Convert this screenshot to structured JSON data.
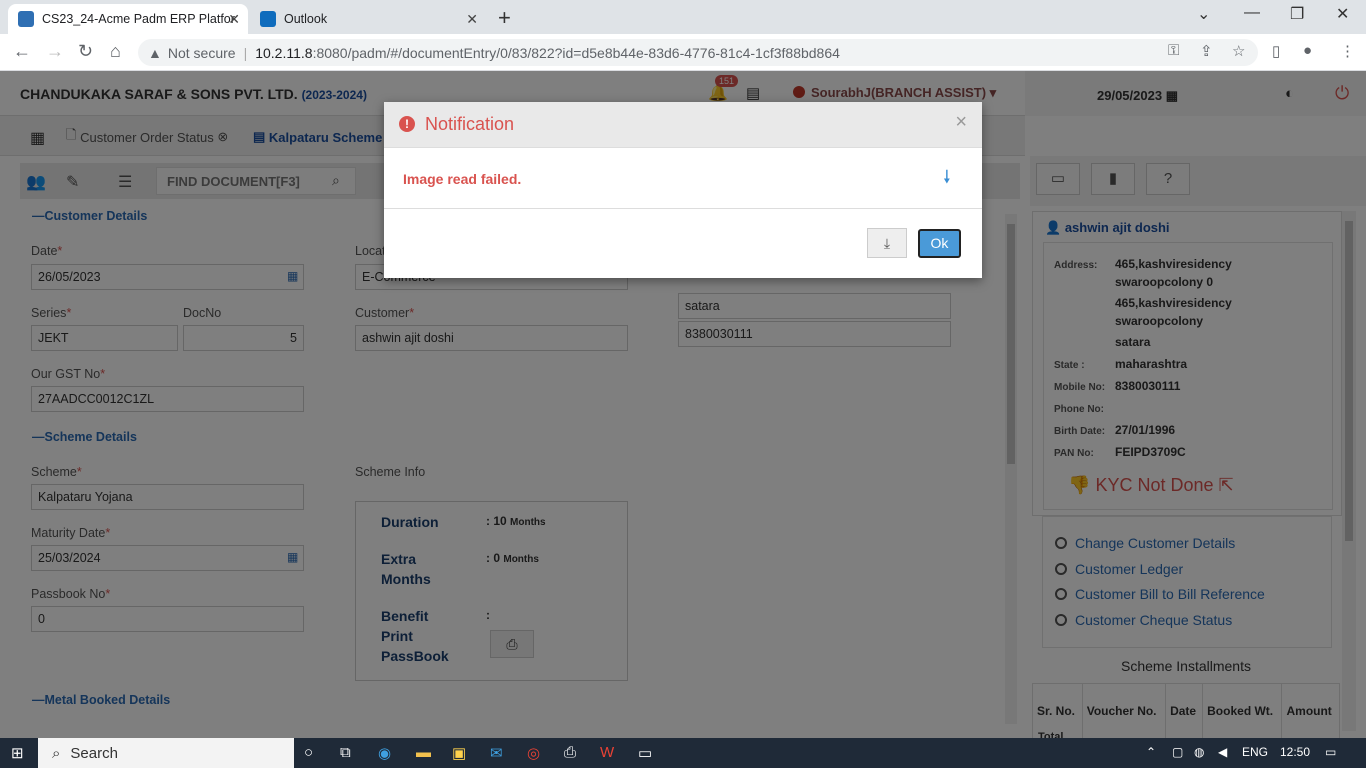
{
  "browser": {
    "tabs": [
      {
        "title": "CS23_24-Acme Padm ERP Platfor",
        "active": true
      },
      {
        "title": "Outlook",
        "active": false
      }
    ],
    "security": "Not secure",
    "url_host": "10.2.11.8",
    "url_rest": ":8080/padm/#/documentEntry/0/83/822?id=d5e8b44e-83d6-4776-81c4-1cf3f88bd864"
  },
  "header": {
    "company": "CHANDUKAKA SARAF & SONS PVT. LTD.",
    "year": "(2023-2024)",
    "notifications": "151",
    "user": "SourabhJ(BRANCH ASSIST)",
    "date": "29/05/2023"
  },
  "app_tabs": [
    "Customer Order Status",
    "Kalpataru Scheme"
  ],
  "toolbar": {
    "find_placeholder": "FIND DOCUMENT[F3]"
  },
  "customer_details": {
    "title": "Customer Details",
    "date_label": "Date",
    "date": "26/05/2023",
    "location_label": "Locat",
    "location": "E-Commerce",
    "series_label": "Series",
    "series": "JEKT",
    "docno_label": "DocNo",
    "docno": "5",
    "customer_label": "Customer",
    "customer": "ashwin ajit doshi",
    "city": "satara",
    "mobile": "8380030111",
    "gst_label": "Our GST No",
    "gst": "27AADCC0012C1ZL"
  },
  "scheme_details": {
    "title": "Scheme Details",
    "scheme_label": "Scheme",
    "scheme": "Kalpataru Yojana",
    "info_label": "Scheme Info",
    "maturity_label": "Maturity Date",
    "maturity": "25/03/2024",
    "passbook_label": "Passbook No",
    "passbook": "0",
    "duration_label": "Duration",
    "duration_num": ": 10",
    "duration_unit": "Months",
    "extra_label": "Extra Months",
    "extra_num": ": 0",
    "extra_unit": "Months",
    "benefit_label": "Benefit",
    "benefit_value": ":",
    "print_label": "Print PassBook"
  },
  "metal_title": "Metal Booked Details",
  "customer_card": {
    "name": "ashwin ajit doshi",
    "address_label": "Address:",
    "address_lines": [
      "465,kashviresidency swaroopcolony 0",
      "465,kashviresidency swaroopcolony",
      "satara"
    ],
    "state_label": "State :",
    "state": "maharashtra",
    "mobile_label": "Mobile No:",
    "mobile": "8380030111",
    "phone_label": "Phone No:",
    "birth_label": "Birth Date:",
    "birth": "27/01/1996",
    "pan_label": "PAN No:",
    "pan": "FEIPD3709C",
    "kyc": "KYC Not Done"
  },
  "customer_links": [
    "Change Customer Details",
    "Customer Ledger",
    "Customer Bill to Bill Reference",
    "Customer Cheque Status"
  ],
  "installments": {
    "title": "Scheme Installments",
    "headers": [
      "Sr. No.",
      "Voucher No.",
      "Date",
      "Booked Wt.",
      "Amount"
    ],
    "total": "Total"
  },
  "modal": {
    "title": "Notification",
    "message": "Image read failed.",
    "ok": "Ok"
  },
  "taskbar": {
    "search": "Search",
    "lang": "ENG",
    "time": "12:50"
  }
}
